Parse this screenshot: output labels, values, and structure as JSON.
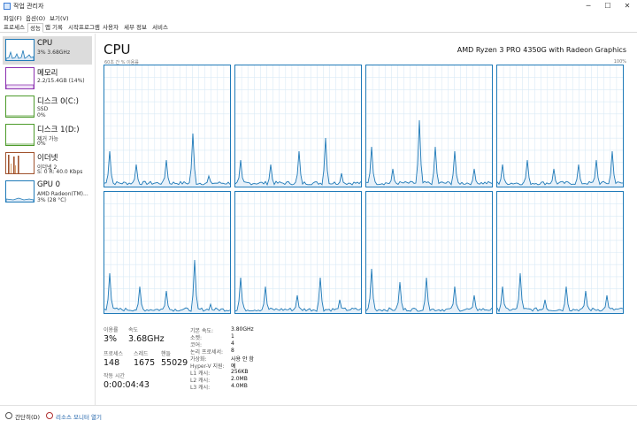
{
  "window": {
    "title": "작업 관리자",
    "minimize": "─",
    "maximize": "☐",
    "close": "✕"
  },
  "menu": [
    "파일(F)",
    "옵션(O)",
    "보기(V)"
  ],
  "tabs": [
    "프로세스",
    "성능",
    "앱 기록",
    "시작프로그램",
    "사용자",
    "세부 정보",
    "서비스"
  ],
  "active_tab": "성능",
  "sidebar": {
    "items": [
      {
        "name": "CPU",
        "sub1": "3% 3.68GHz",
        "sub2": "",
        "color": "#1f7ab8"
      },
      {
        "name": "메모리",
        "sub1": "2.2/15.4GB (14%)",
        "sub2": "",
        "color": "#8b2fb0"
      },
      {
        "name": "디스크 0(C:)",
        "sub1": "SSD",
        "sub2": "0%",
        "color": "#4c9a2a"
      },
      {
        "name": "디스크 1(D:)",
        "sub1": "제거 가능",
        "sub2": "0%",
        "color": "#4c9a2a"
      },
      {
        "name": "이더넷",
        "sub1": "이더넷 2",
        "sub2": "S: 0 R: 40.0 Kbps",
        "color": "#a0522d"
      },
      {
        "name": "GPU 0",
        "sub1": "AMD Radeon(TM)...",
        "sub2": "3% (28 °C)",
        "color": "#1f7ab8"
      }
    ]
  },
  "main": {
    "title": "CPU",
    "model": "AMD Ryzen 3 PRO 4350G with Radeon Graphics",
    "graph_left_label": "60초 간 % 이용률",
    "graph_right_label": "100%",
    "line_color": "#1f7ab8",
    "grid_color": "#d9eaf6"
  },
  "stats": {
    "usage_label": "이용률",
    "usage_value": "3%",
    "speed_label": "속도",
    "speed_value": "3.68GHz",
    "processes_label": "프로세스",
    "processes_value": "148",
    "threads_label": "스레드",
    "threads_value": "1675",
    "handles_label": "핸들",
    "handles_value": "55029",
    "uptime_label": "작동 시간",
    "uptime_value": "0:00:04:43"
  },
  "specs": [
    {
      "label": "기본 속도:",
      "value": "3.80GHz"
    },
    {
      "label": "소켓:",
      "value": "1"
    },
    {
      "label": "코어:",
      "value": "4"
    },
    {
      "label": "논리 프로세서:",
      "value": "8"
    },
    {
      "label": "가상화:",
      "value": "사용 안 함"
    },
    {
      "label": "Hyper-V 지원:",
      "value": "예"
    },
    {
      "label": "L1 캐시:",
      "value": "256KB"
    },
    {
      "label": "L2 캐시:",
      "value": "2.0MB"
    },
    {
      "label": "L3 캐시:",
      "value": "4.0MB"
    }
  ],
  "bottom": {
    "brief_label": "간단히(D)",
    "resmon_label": "리소스 모니터 열기"
  }
}
